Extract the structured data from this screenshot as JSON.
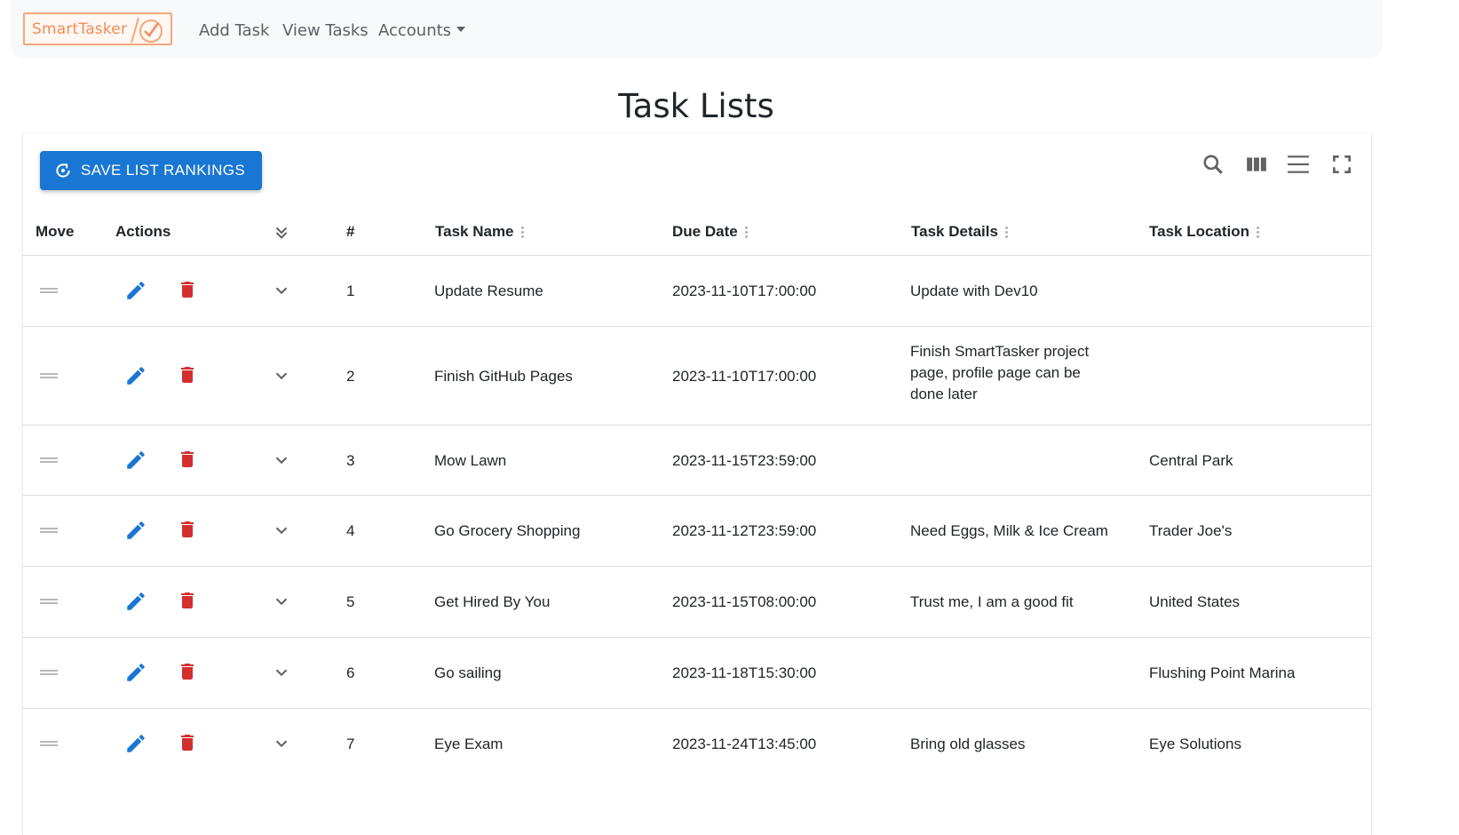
{
  "nav": {
    "logo_text": "SmartTasker",
    "links": [
      "Add Task",
      "View Tasks",
      "Accounts"
    ]
  },
  "page_title": "Task Lists",
  "toolbar": {
    "save_label": "SAVE LIST RANKINGS",
    "icons": [
      "search-icon",
      "columns-icon",
      "density-icon",
      "fullscreen-icon"
    ]
  },
  "table": {
    "headers": {
      "move": "Move",
      "actions": "Actions",
      "index": "#",
      "task_name": "Task Name",
      "due_date": "Due Date",
      "task_details": "Task Details",
      "task_location": "Task Location"
    },
    "rows": [
      {
        "index": "1",
        "name": "Update Resume",
        "due": "2023-11-10T17:00:00",
        "details": "Update with Dev10",
        "location": ""
      },
      {
        "index": "2",
        "name": "Finish GitHub Pages",
        "due": "2023-11-10T17:00:00",
        "details": "Finish SmartTasker project page, profile page can be done later",
        "location": ""
      },
      {
        "index": "3",
        "name": "Mow Lawn",
        "due": "2023-11-15T23:59:00",
        "details": "",
        "location": "Central Park"
      },
      {
        "index": "4",
        "name": "Go Grocery Shopping",
        "due": "2023-11-12T23:59:00",
        "details": "Need Eggs, Milk & Ice Cream",
        "location": "Trader Joe's"
      },
      {
        "index": "5",
        "name": "Get Hired By You",
        "due": "2023-11-15T08:00:00",
        "details": "Trust me, I am a good fit",
        "location": "United States"
      },
      {
        "index": "6",
        "name": "Go sailing",
        "due": "2023-11-18T15:30:00",
        "details": "",
        "location": "Flushing Point Marina"
      },
      {
        "index": "7",
        "name": "Eye Exam",
        "due": "2023-11-24T13:45:00",
        "details": "Bring old glasses",
        "location": "Eye Solutions"
      }
    ]
  },
  "colors": {
    "primary": "#1976d2",
    "edit": "#1976d2",
    "delete": "#d32f2f",
    "logo": "#f08c5a",
    "navbar_bg": "#f8f9fa"
  }
}
